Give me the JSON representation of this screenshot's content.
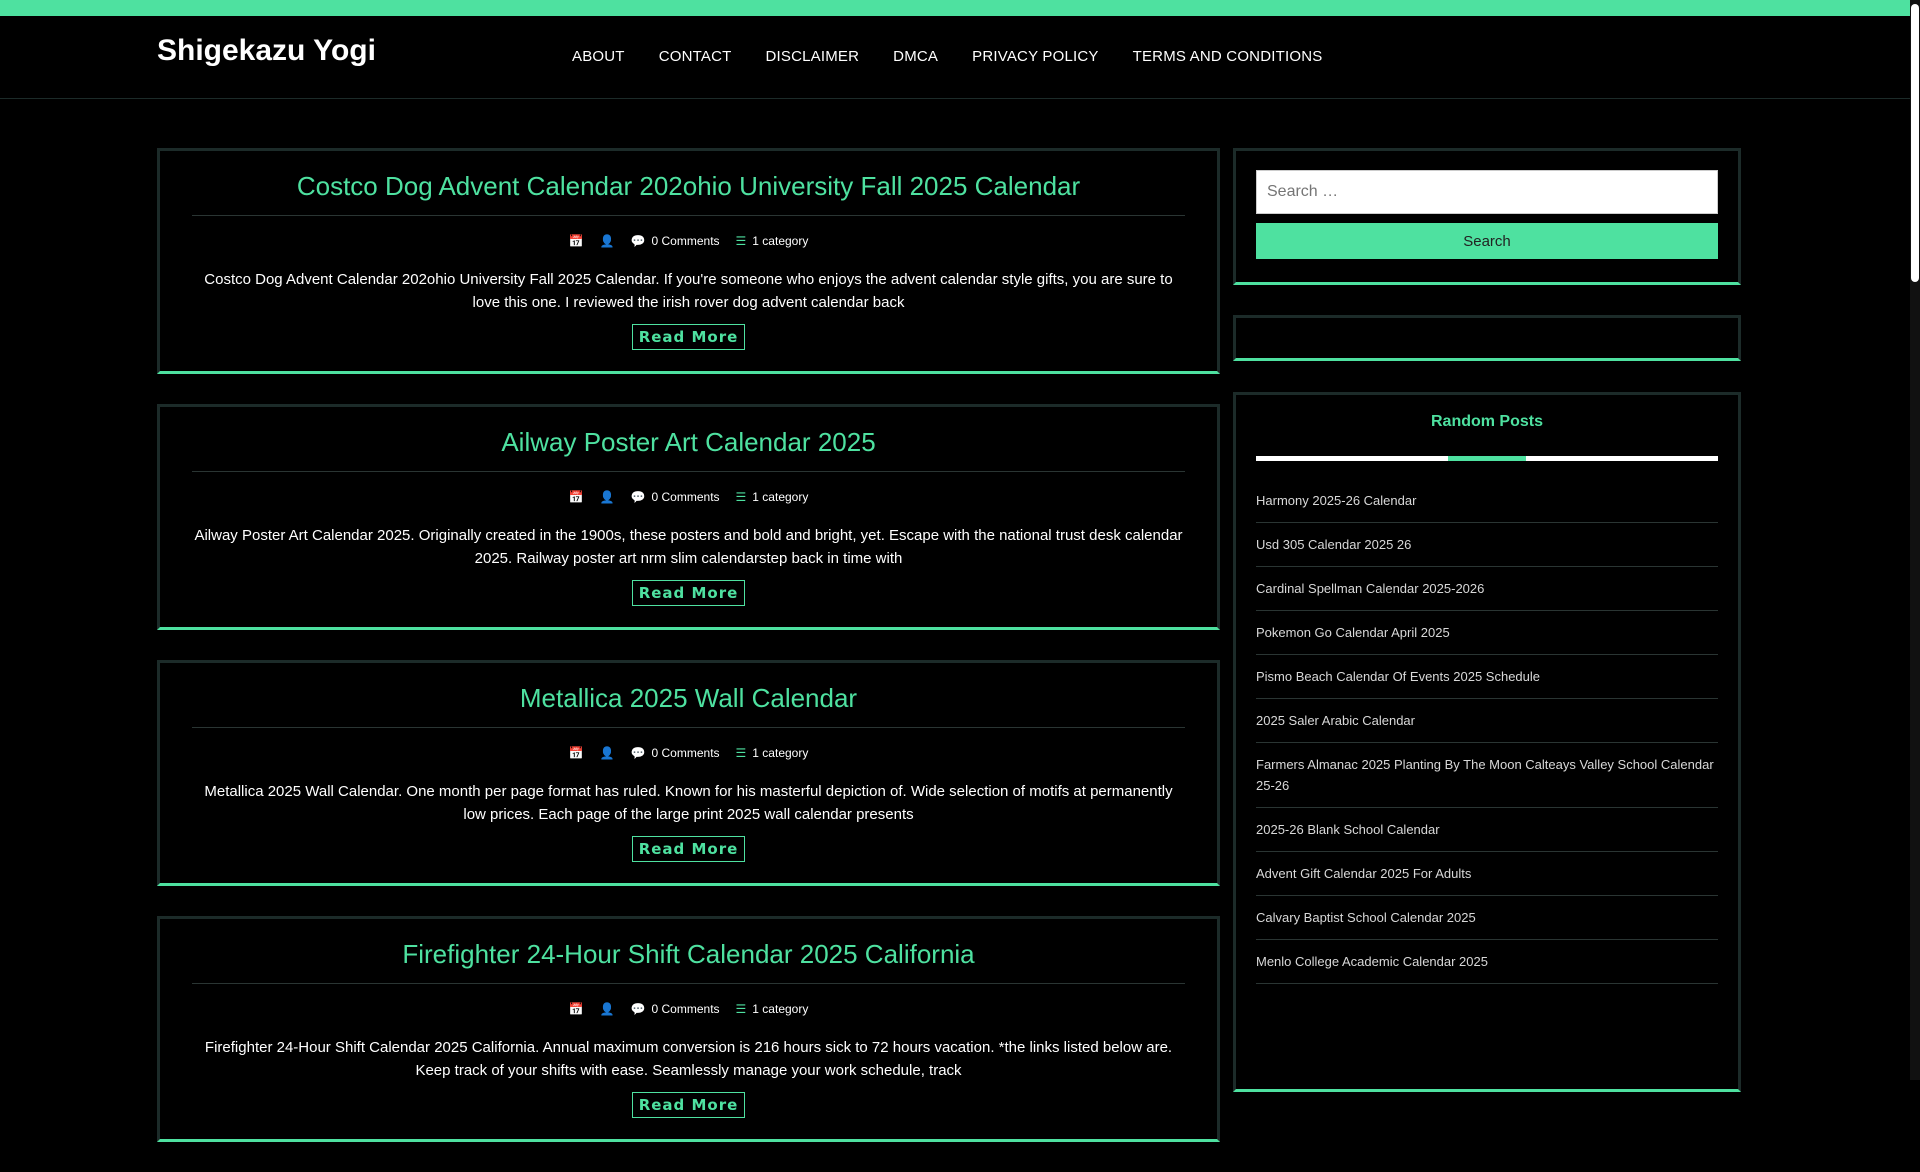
{
  "site": {
    "title": "Shigekazu Yogi"
  },
  "nav": {
    "items": [
      "ABOUT",
      "CONTACT",
      "DISCLAIMER",
      "DMCA",
      "PRIVACY POLICY",
      "TERMS AND CONDITIONS"
    ]
  },
  "colors": {
    "accent": "#4ee1a0",
    "background": "#000000",
    "border": "#1c2b29"
  },
  "posts": [
    {
      "title": "Costco Dog Advent Calendar 202ohio University Fall 2025 Calendar",
      "comments": "0 Comments",
      "category": "1 category",
      "excerpt": "Costco Dog Advent Calendar 202ohio University Fall 2025 Calendar. If you're someone who enjoys the advent calendar style gifts, you are sure to love this one. I reviewed the irish rover dog advent calendar back",
      "read_more": "Read More"
    },
    {
      "title": "Ailway Poster Art Calendar 2025",
      "comments": "0 Comments",
      "category": "1 category",
      "excerpt": "Ailway Poster Art Calendar 2025. Originally created in the 1900s, these posters and bold and bright, yet. Escape with the national trust desk calendar 2025. Railway poster art nrm slim calendarstep back in time with",
      "read_more": "Read More"
    },
    {
      "title": "Metallica 2025 Wall Calendar",
      "comments": "0 Comments",
      "category": "1 category",
      "excerpt": "Metallica 2025 Wall Calendar. One month per page format has ruled. Known for his masterful depiction of. Wide selection of motifs at permanently low prices. Each page of the large print 2025 wall calendar presents",
      "read_more": "Read More"
    },
    {
      "title": "Firefighter 24-Hour Shift Calendar 2025 California",
      "comments": "0 Comments",
      "category": "1 category",
      "excerpt": "Firefighter 24-Hour Shift Calendar 2025 California. Annual maximum conversion is 216 hours sick to 72 hours vacation. *the links listed below are. Keep track of your shifts with ease. Seamlessly manage your work schedule, track",
      "read_more": "Read More"
    }
  ],
  "sidebar": {
    "search": {
      "placeholder": "Search …",
      "button": "Search"
    },
    "random_posts": {
      "title": "Random Posts",
      "items": [
        "Harmony 2025-26 Calendar",
        "Usd 305 Calendar 2025 26",
        "Cardinal Spellman Calendar 2025-2026",
        "Pokemon Go Calendar April 2025",
        "Pismo Beach Calendar Of Events 2025 Schedule",
        "2025 Saler Arabic Calendar",
        "Farmers Almanac 2025 Planting By The Moon Calteays Valley School Calendar 25-26",
        "2025-26 Blank School Calendar",
        "Advent Gift Calendar 2025 For Adults",
        "Calvary Baptist School Calendar 2025",
        "Menlo College Academic Calendar 2025"
      ]
    }
  }
}
